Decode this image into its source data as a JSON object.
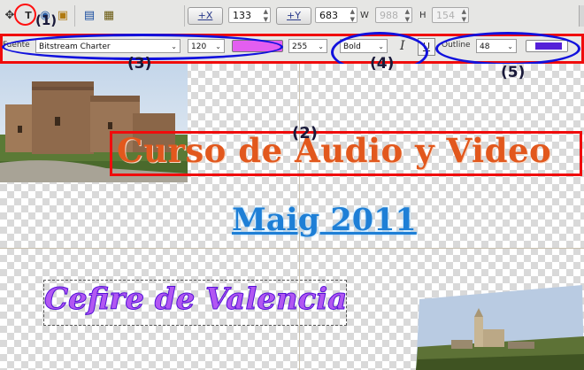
{
  "toolbar": {
    "pos_x_label": "+X",
    "x_value": "133",
    "pos_y_label": "+Y",
    "y_value": "683",
    "w_label": "W",
    "w_value": "988",
    "h_label": "H",
    "h_value": "154"
  },
  "font_bar": {
    "font_label": "Fuente",
    "font_name": "Bitstream Charter",
    "font_size": "120",
    "opacity": "255",
    "weight": "Bold",
    "italic_glyph": "I",
    "outline_label": "Outline",
    "outline_size": "48"
  },
  "annotations": {
    "n1": "(1)",
    "n2": "(2)",
    "n3": "(3)",
    "n4": "(4)",
    "n5": "(5)"
  },
  "canvas": {
    "title": "Curso de Audio y Video",
    "date": "Maig 2011",
    "org": "Cefire de Valencia"
  },
  "colors": {
    "title": "#e2581d",
    "date": "#1e7fd6",
    "org_fill": "#b257f2",
    "org_outline": "#5211d6",
    "text_color_swatch": "#e35ef0",
    "outline_color_swatch": "#5520d8",
    "annotation_red": "#f00c0c",
    "annotation_blue": "#1111dd"
  },
  "icons": [
    "pointer-icon",
    "text-tool-icon",
    "zoom-icon",
    "image-icon",
    "save-icon",
    "save-as-icon"
  ]
}
